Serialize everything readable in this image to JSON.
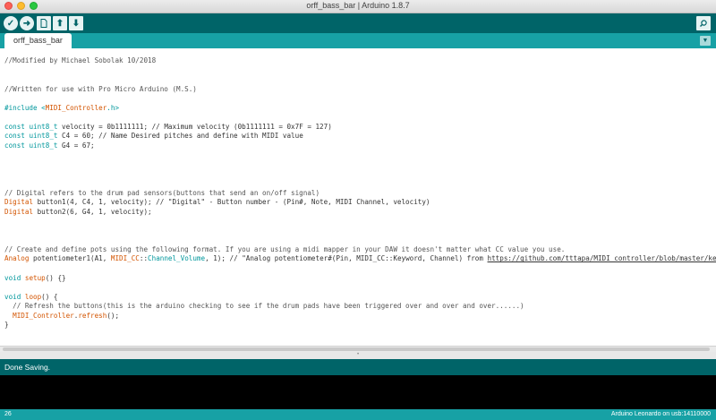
{
  "window": {
    "title": "orff_bass_bar | Arduino 1.8.7"
  },
  "toolbar": {
    "verify_icon": "checkmark-icon",
    "upload_icon": "arrow-right-icon",
    "new_icon": "new-file-icon",
    "open_icon": "arrow-up-icon",
    "save_icon": "arrow-down-icon",
    "serial_monitor_icon": "magnifier-icon"
  },
  "tabs": [
    {
      "label": "orff_bass_bar"
    }
  ],
  "code": {
    "l1": "//Modified by Michael Sobolak 10/2018",
    "l2": "//Written for use with Pro Micro Arduino (M.S.)",
    "l3a": "#include <",
    "l3b": "MIDI_Controller",
    "l3c": ".h>",
    "l4a": "const",
    "l4b": "uint8_t",
    "l4c": " velocity = 0b1111111; // Maximum velocity (0b1111111 = 0x7F = 127)",
    "l5c": " C4 = 60; // Name Desired pitches and define with MIDI value",
    "l6c": " G4 = 67;",
    "l7": "// Digital refers to the drum pad sensors(buttons that send an on/off signal)",
    "l8a": "Digital",
    "l8b": " button1(4, C4, 1, velocity); // \"Digital\" - Button number - (Pin#, Note, MIDI Channel, velocity)",
    "l9b": " button2(6, G4, 1, velocity);",
    "l10": "// Create and define pots using the following format. If you are using a midi mapper in your DAW it doesn't matter what CC value you use.",
    "l11a": "Analog",
    "l11b": " potentiometer1(A1, ",
    "l11c": "MIDI_CC",
    "l11d": "::",
    "l11e": "Channel_Volume",
    "l11f": ", 1); // \"Analog potentiometer#(Pin, MIDI_CC::Keyword, Channel) from ",
    "l11g": "https://github.com/tttapa/MIDI_controller/blob/master/keywords",
    "l12a": "void",
    "l12b": "setup",
    "l12c": "() {}",
    "l13b": "loop",
    "l13c": "() {",
    "l14": "  // Refresh the buttons(this is the arduino checking to see if the drum pads have been triggered over and over and over......)",
    "l15a": "MIDI_Controller",
    "l15b": ".",
    "l15c": "refresh",
    "l15d": "();",
    "l16": "}"
  },
  "status": {
    "message": "Done Saving."
  },
  "footer": {
    "line_number": "26",
    "board": "Arduino Leonardo on usb:14110000"
  }
}
